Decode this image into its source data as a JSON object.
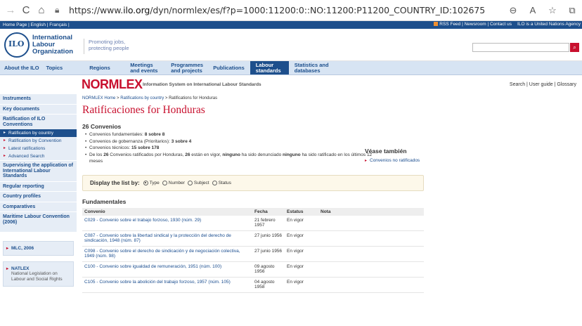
{
  "browser": {
    "url_prefix": "https://www.",
    "url_host": "ilo.org",
    "url_path": "/dyn/normlex/es/f?p=1000:11200:0::NO:11200:P11200_COUNTRY_ID:102675"
  },
  "topstrip": {
    "left": "Home Page | English | Français |",
    "rss": "RSS Feed | Newsroom | Contact us",
    "un": "ILO is a United Nations Agency"
  },
  "header": {
    "logo_line1": "International",
    "logo_line2": "Labour",
    "logo_line3": "Organization",
    "tagline1": "Promoting jobs,",
    "tagline2": "protecting people"
  },
  "nav": {
    "items": [
      "About the ILO",
      "Topics",
      "Regions",
      "Meetings and events",
      "Programmes and projects",
      "Publications",
      "Labour standards",
      "Statistics and databases"
    ]
  },
  "normlex": {
    "logo": "NORMLEX",
    "subtitle": "Information System on International Labour Standards",
    "links": "Search | User guide | Glossary"
  },
  "sidebar": {
    "items": {
      "instruments": "Instruments",
      "key_documents": "Key documents",
      "ratification": "Ratification of ILO Conventions",
      "by_country": "Ratification by country",
      "by_convention": "Ratification by Convention",
      "latest": "Latest ratifications",
      "advanced": "Advanced Search",
      "supervising": "Supervising the application of International Labour Standards",
      "regular": "Regular reporting",
      "profiles": "Country profiles",
      "comparatives": "Comparatives",
      "maritime": "Maritime Labour Convention (2006)"
    },
    "mlc": "MLC, 2006",
    "natlex_title": "NATLEX",
    "natlex_desc": "National Legislation on Labour and Social Rights"
  },
  "main": {
    "breadcrumb_home": "NORMLEX Home",
    "breadcrumb_mid": "Ratifications by country",
    "breadcrumb_current": "Ratifications for Honduras",
    "title": "Ratificaciones for Honduras",
    "count": "26 Convenios",
    "bullets": {
      "b1_pre": "Convenios fundamentales: ",
      "b1_val": "8 sobre 8",
      "b2_pre": "Convenios de gobernanza (Prioritarios): ",
      "b2_val": "3 sobre 4",
      "b3_pre": "Convenios técnicos: ",
      "b3_val": "15 sobre 178",
      "b4_a": "De los ",
      "b4_b": "26",
      "b4_c": " Convenios ratificados por Honduras, ",
      "b4_d": "26",
      "b4_e": " están en vigor, ",
      "b4_f": "ninguno",
      "b4_g": " ha sido denunciado ",
      "b4_h": "ninguno",
      "b4_i": " ha sido ratificado en los últimos 12 meses"
    },
    "seealso_title": "Véase también",
    "seealso_link": "Convenios no ratificados",
    "display_label": "Display the list by:",
    "display_options": [
      "Type",
      "Number",
      "Subject",
      "Status"
    ],
    "section": "Fundamentales",
    "table": {
      "headers": [
        "Convenio",
        "Fecha",
        "Estatus",
        "Nota"
      ],
      "rows": [
        {
          "code": "C029",
          "name": " - Convenio sobre el trabajo forzoso, 1930 (núm. 29)",
          "date": "21 febrero 1957",
          "status": "En vigor"
        },
        {
          "code": "C087",
          "name": " - Convenio sobre la libertad sindical y la protección del derecho de sindicación, 1948 (núm. 87)",
          "date": "27 junio 1956",
          "status": "En vigor"
        },
        {
          "code": "C098",
          "name": " - Convenio sobre el derecho de sindicación y de negociación colectiva, 1949 (núm. 98)",
          "date": "27 junio 1956",
          "status": "En vigor"
        },
        {
          "code": "C100",
          "name": " - Convenio sobre igualdad de remuneración, 1951 (núm. 100)",
          "date": "09 agosto 1956",
          "status": "En vigor"
        },
        {
          "code": "C105",
          "name": " - Convenio sobre la abolición del trabajo forzoso, 1957 (núm. 105)",
          "date": "04 agosto 1958",
          "status": "En vigor"
        }
      ]
    }
  }
}
